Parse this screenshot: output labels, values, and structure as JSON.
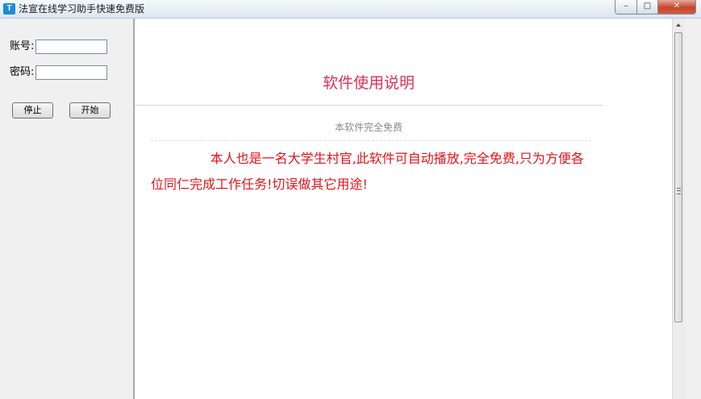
{
  "window": {
    "title": "法宣在线学习助手快速免费版",
    "icon_glyph": "T",
    "controls": {
      "minimize": "–",
      "maximize": "□",
      "close": "✕"
    }
  },
  "login": {
    "account_label": "账号:",
    "account_value": "",
    "password_label": "密码:",
    "password_value": ""
  },
  "buttons": {
    "stop": "停止",
    "start": "开始"
  },
  "document": {
    "title": "软件使用说明",
    "subtitle": "本软件完全免费",
    "body": "本人也是一名大学生村官,此软件可自动播放,完全免费,只为方便各位同仁完成工作任务!切误做其它用途!"
  },
  "colors": {
    "title": "#e0305a",
    "body": "#e4141a",
    "subtitle": "#8a8a8a",
    "icon": "#1d8bd6"
  }
}
